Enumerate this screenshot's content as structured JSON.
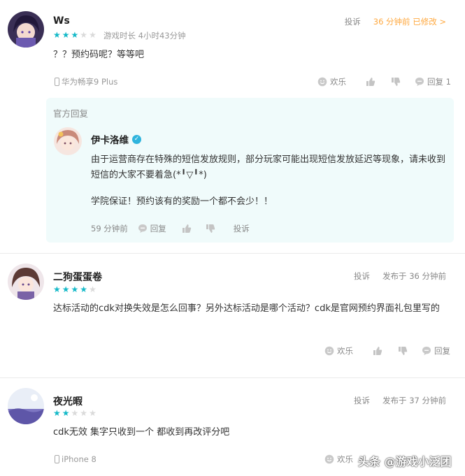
{
  "reviews": [
    {
      "username": "Ws",
      "rating": 3,
      "playtime": "游戏时长 4小时43分钟",
      "report_label": "投诉",
      "time_label": "36 分钟前 已修改 >",
      "body": "？？预约码呢？等等吧",
      "device": "华为畅享9 Plus",
      "actions": {
        "fun": "欢乐",
        "reply": "回复 1"
      },
      "official_reply": {
        "section_label": "官方回复",
        "dev_name": "伊卡洛维",
        "paragraph1": "由于运营商存在特殊的短信发放规则，部分玩家可能出现短信发放延迟等现象，请未收到短信的大家不要着急(*╹▽╹*)",
        "paragraph2": "学院保证！预约该有的奖励一个都不会少！！",
        "time": "59 分钟前",
        "reply": "回复",
        "report": "投诉"
      }
    },
    {
      "username": "二狗蛋蛋卷",
      "rating": 4,
      "report_label": "投诉",
      "time_label": "发布于 36 分钟前",
      "body": "达标活动的cdk对换失效是怎么回事？另外达标活动是哪个活动？cdk是官网预约界面礼包里写的",
      "actions": {
        "fun": "欢乐",
        "reply": "回复"
      }
    },
    {
      "username": "夜光暇",
      "rating": 2,
      "report_label": "投诉",
      "time_label": "发布于 37 分钟前",
      "body": "cdk无效 集字只收到一个 都收到再改评分吧",
      "device": "iPhone 8",
      "actions": {
        "fun": "欢乐"
      }
    }
  ],
  "watermark": "头条 @游戏小泛团",
  "colors": {
    "star": "#14b9c8",
    "accent": "#ffa940",
    "reply_bg": "#f0fbfb",
    "verified": "#2fb4dd"
  },
  "icons": [
    "smile-icon",
    "thumb-up-icon",
    "thumb-down-icon",
    "comment-icon",
    "phone-icon",
    "verified-icon"
  ]
}
